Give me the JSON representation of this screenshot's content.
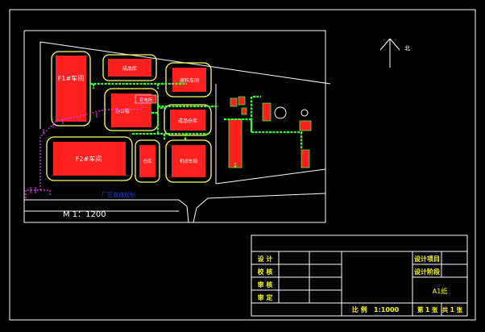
{
  "drawing": {
    "north_label": "北",
    "scale_note": "M  1：1200",
    "road_label": "厂区道路规划",
    "blocks": {
      "f1": "F1#车间",
      "f2": "F2#车间",
      "top_small": "成品库",
      "top_right": "原料车间",
      "mid_center": "办公楼",
      "mid_tag": "变电所",
      "mid_right": "成品仓库",
      "bottom_mid": "仓库",
      "bottom_right": "机修车间"
    }
  },
  "title_block": {
    "rows": [
      "设 计",
      "校 核",
      "审 核",
      "审 定"
    ],
    "design_project": "设计项目",
    "design_stage": "设计阶段",
    "paper": "A1纸",
    "scale": "比 例   1:1000",
    "sheet": "第 1 张  共 1 张"
  },
  "colors": {
    "frame": "#ffffff",
    "building_outline": "#ffff66",
    "building_fill": "#ff2020",
    "pipe": "#33ff33",
    "magenta": "#ff33ff",
    "blue_label": "#2244ff",
    "title_text": "#ffff00"
  }
}
